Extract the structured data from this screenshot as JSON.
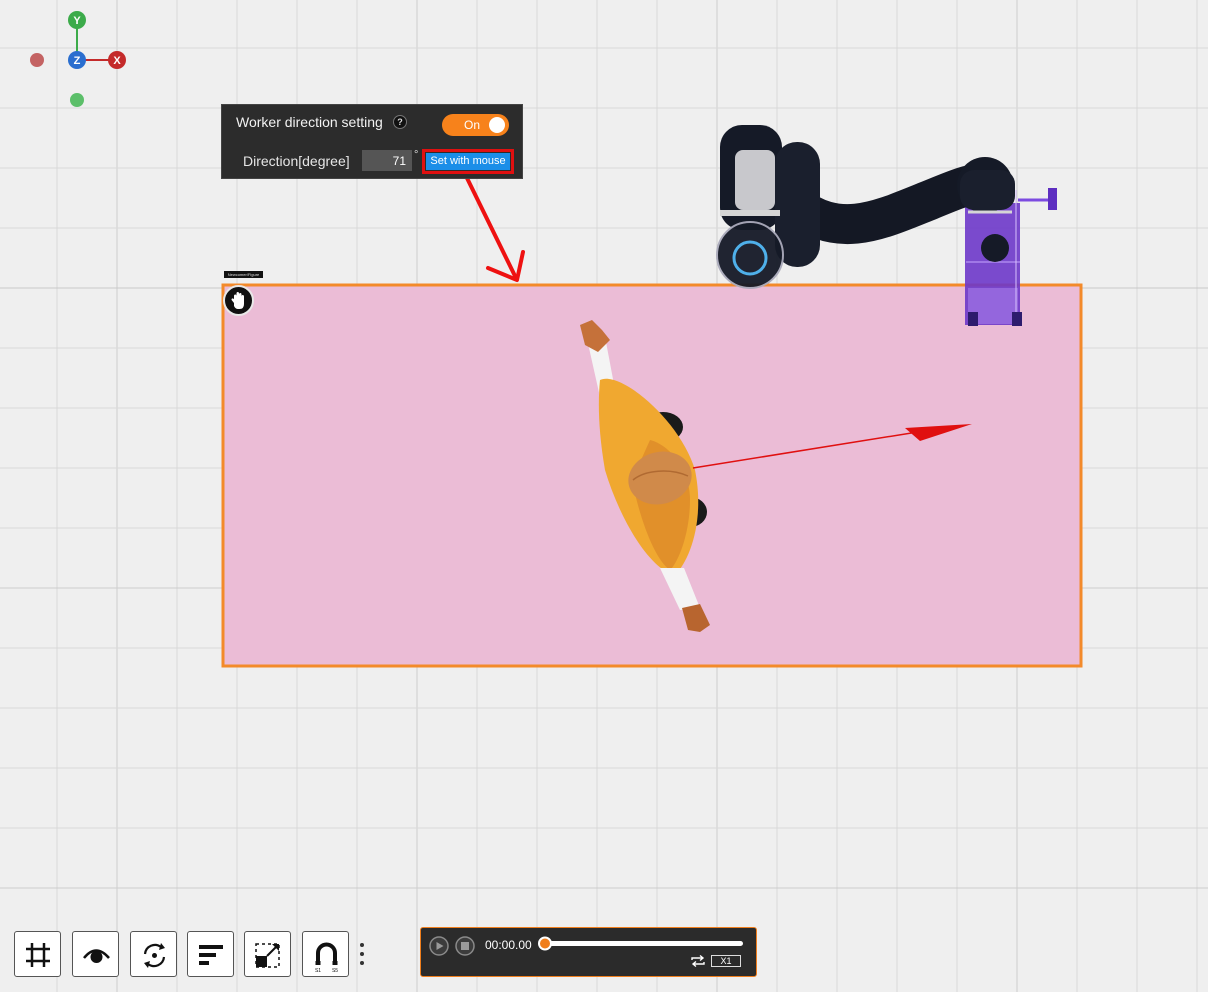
{
  "axes_gizmo": {
    "y_label": "Y",
    "z_label": "Z",
    "x_label": "X",
    "colors": {
      "y": "#3cab4a",
      "z": "#2a6ecf",
      "x": "#c42a2a"
    }
  },
  "direction_panel": {
    "title": "Worker direction setting",
    "help_glyph": "?",
    "toggle_label": "On",
    "toggle_state": true,
    "direction_label": "Direction[degree]",
    "direction_value": "71",
    "degree_symbol": "°",
    "set_with_mouse_label": "Set with mouse",
    "accent_color": "#f7821b",
    "button_color": "#1b8ee8",
    "highlight_color": "#e01010"
  },
  "work_area": {
    "tag_label": "Newcomer/Figure",
    "fill_color": "#ebbcd6",
    "border_color": "#f38a2a"
  },
  "toolbar": {
    "buttons": [
      {
        "name": "grid-button",
        "icon": "grid-icon"
      },
      {
        "name": "view-button",
        "icon": "eye-icon"
      },
      {
        "name": "rotate-button",
        "icon": "rotate-icon"
      },
      {
        "name": "align-button",
        "icon": "align-left-icon"
      },
      {
        "name": "scale-button",
        "icon": "resize-icon"
      },
      {
        "name": "snap-button",
        "icon": "magnet-icon"
      }
    ]
  },
  "timeline": {
    "time": "00:00.00",
    "speed": "X1",
    "progress": 0,
    "accent_color": "#f07e1c"
  }
}
